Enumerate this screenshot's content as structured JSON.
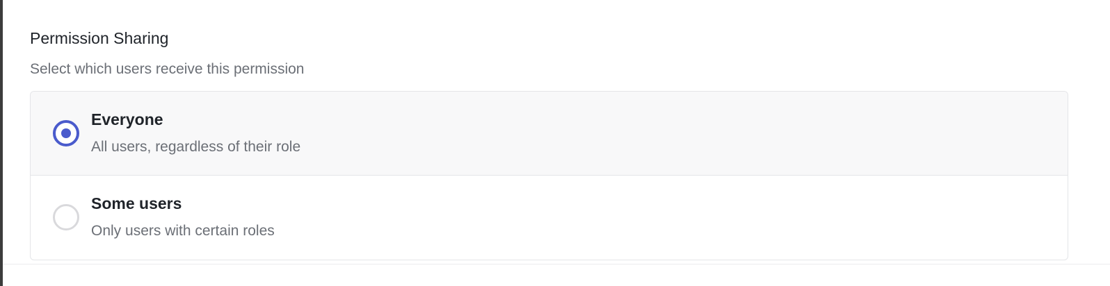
{
  "section": {
    "title": "Permission Sharing",
    "subtitle": "Select which users receive this permission"
  },
  "options": [
    {
      "label": "Everyone",
      "description": "All users, regardless of their role",
      "selected": true
    },
    {
      "label": "Some users",
      "description": "Only users with certain roles",
      "selected": false
    }
  ],
  "colors": {
    "accent": "#4a5bcc",
    "selected_background": "#f8f8f9",
    "border": "#e4e5e8",
    "title_text": "#1f2329",
    "muted_text": "#6b6f76"
  }
}
